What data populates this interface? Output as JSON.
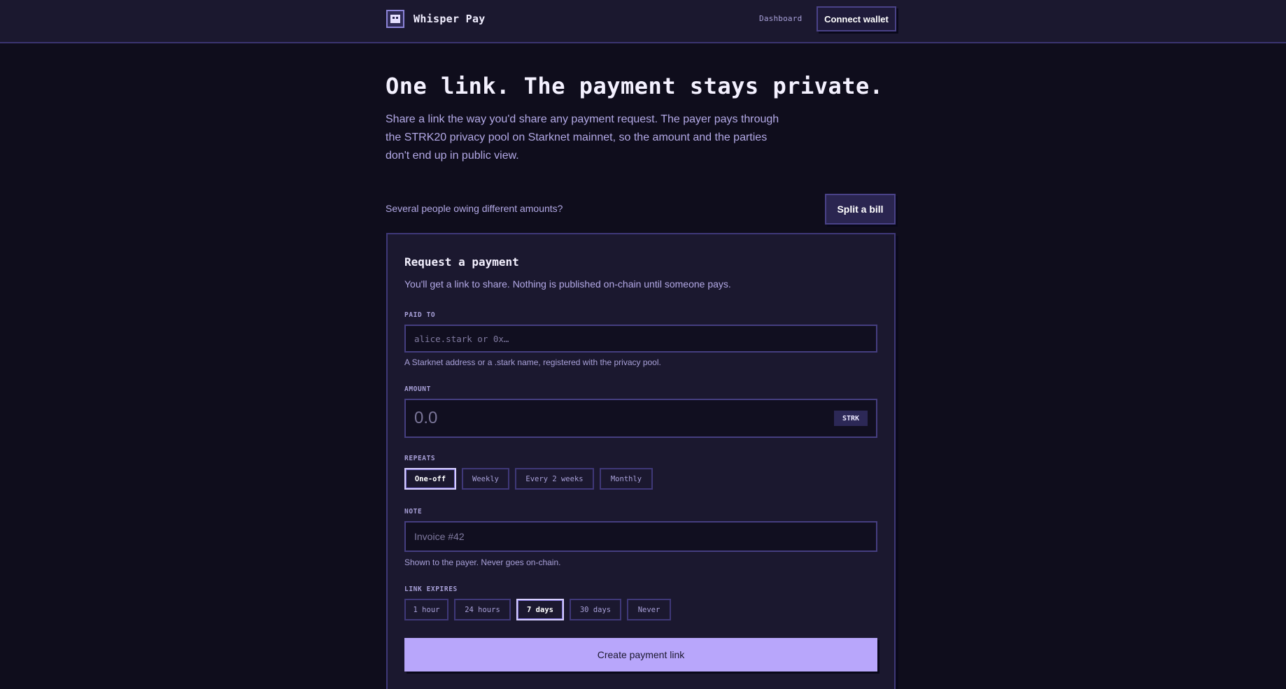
{
  "header": {
    "brand_name": "Whisper Pay",
    "logo_icon": "whisper-pay-logo-icon",
    "nav_dashboard": "Dashboard",
    "connect_wallet": "Connect wallet"
  },
  "hero": {
    "title": "One link. The payment stays private.",
    "subtitle": "Share a link the way you'd share any payment request. The payer pays through the STRK20 privacy pool on Starknet mainnet, so the amount and the parties don't end up in public view."
  },
  "split": {
    "prompt": "Several people owing different amounts?",
    "button": "Split a bill"
  },
  "form": {
    "title": "Request a payment",
    "subtitle": "You'll get a link to share. Nothing is published on-chain until someone pays.",
    "paid_to": {
      "label": "PAID TO",
      "placeholder": "alice.stark or 0x…",
      "value": "",
      "hint": "A Starknet address or a .stark name, registered with the privacy pool."
    },
    "amount": {
      "label": "AMOUNT",
      "placeholder": "0.0",
      "value": "",
      "unit": "STRK"
    },
    "repeats": {
      "label": "REPEATS",
      "options": [
        "One-off",
        "Weekly",
        "Every 2 weeks",
        "Monthly"
      ],
      "selected": "One-off"
    },
    "note": {
      "label": "NOTE",
      "placeholder": "Invoice #42",
      "value": "",
      "hint": "Shown to the payer. Never goes on-chain."
    },
    "link_expires": {
      "label": "LINK EXPIRES",
      "options": [
        "1 hour",
        "24 hours",
        "7 days",
        "30 days",
        "Never"
      ],
      "selected": "7 days"
    },
    "submit": "Create payment link"
  },
  "colors": {
    "page_bg": "#0f0d1c",
    "panel_bg": "#1b182f",
    "border": "#3f3878",
    "accent": "#b8a6fb",
    "muted_text": "#b3a9e6"
  }
}
